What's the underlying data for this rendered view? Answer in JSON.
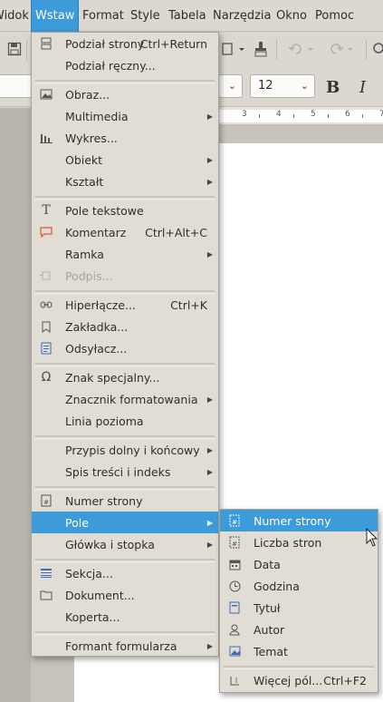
{
  "menubar": {
    "items": [
      {
        "label": "Widok"
      },
      {
        "label": "Wstaw"
      },
      {
        "label": "Format"
      },
      {
        "label": "Style"
      },
      {
        "label": "Tabela"
      },
      {
        "label": "Narzędzia"
      },
      {
        "label": "Okno"
      },
      {
        "label": "Pomoc"
      }
    ],
    "active_color": "#3d9bd9"
  },
  "toolbar": {
    "font_size": "12",
    "bold_label": "B",
    "italic_label": "I"
  },
  "ruler": {
    "numbers": [
      "3",
      "4",
      "5",
      "6",
      "7"
    ]
  },
  "insert_menu": {
    "items": [
      {
        "label": "Podział strony",
        "shortcut": "Ctrl+Return",
        "icon": "page-break-icon"
      },
      {
        "label": "Podział ręczny..."
      },
      {
        "label": "Obraz...",
        "icon": "image-icon"
      },
      {
        "label": "Multimedia",
        "submenu": true
      },
      {
        "label": "Wykres...",
        "icon": "chart-icon"
      },
      {
        "label": "Obiekt",
        "submenu": true
      },
      {
        "label": "Kształt",
        "submenu": true
      },
      {
        "label": "Pole tekstowe",
        "icon": "text-box-icon"
      },
      {
        "label": "Komentarz",
        "shortcut": "Ctrl+Alt+C",
        "icon": "comment-icon"
      },
      {
        "label": "Ramka",
        "submenu": true
      },
      {
        "label": "Podpis...",
        "disabled": true,
        "icon": "caption-icon"
      },
      {
        "label": "Hiperłącze...",
        "shortcut": "Ctrl+K",
        "icon": "hyperlink-icon"
      },
      {
        "label": "Zakładka...",
        "icon": "bookmark-icon"
      },
      {
        "label": "Odsyłacz...",
        "icon": "cross-reference-icon"
      },
      {
        "label": "Znak specjalny...",
        "icon": "omega-icon"
      },
      {
        "label": "Znacznik formatowania",
        "submenu": true
      },
      {
        "label": "Linia pozioma"
      },
      {
        "label": "Przypis dolny i końcowy",
        "submenu": true
      },
      {
        "label": "Spis treści i indeks",
        "submenu": true
      },
      {
        "label": "Numer strony",
        "icon": "page-number-icon"
      },
      {
        "label": "Pole",
        "submenu": true,
        "highlighted": true
      },
      {
        "label": "Główka i stopka",
        "submenu": true
      },
      {
        "label": "Sekcja...",
        "icon": "section-icon"
      },
      {
        "label": "Dokument...",
        "icon": "folder-icon"
      },
      {
        "label": "Koperta..."
      },
      {
        "label": "Formant formularza",
        "submenu": true
      }
    ]
  },
  "field_submenu": {
    "items": [
      {
        "label": "Numer strony",
        "icon": "page-number-icon",
        "highlighted": true
      },
      {
        "label": "Liczba stron",
        "icon": "page-count-icon"
      },
      {
        "label": "Data",
        "icon": "calendar-icon"
      },
      {
        "label": "Godzina",
        "icon": "clock-icon"
      },
      {
        "label": "Tytuł",
        "icon": "title-icon"
      },
      {
        "label": "Autor",
        "icon": "author-icon"
      },
      {
        "label": "Temat",
        "icon": "subject-icon"
      },
      {
        "label": "Więcej pól...",
        "shortcut": "Ctrl+F2",
        "icon": "more-fields-icon"
      }
    ]
  },
  "colors": {
    "highlight": "#3d9bd9",
    "menu_bg": "#e1ddd4"
  }
}
